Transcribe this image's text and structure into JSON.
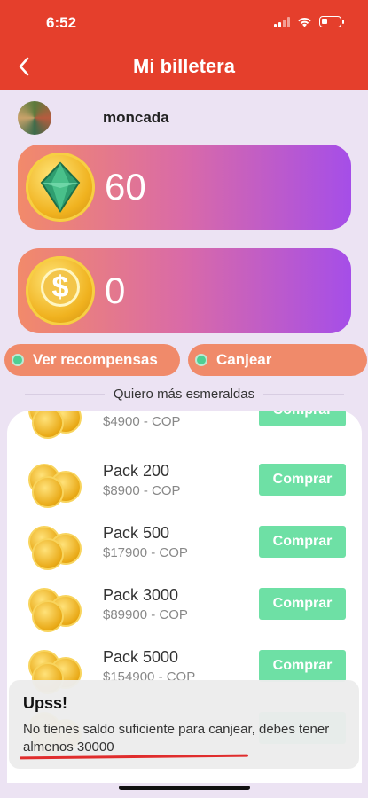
{
  "status": {
    "time": "6:52"
  },
  "header": {
    "back_icon": "back-chevron-icon",
    "title": "Mi billetera"
  },
  "user": {
    "name": "moncada"
  },
  "balances": {
    "emeralds": "60",
    "coins": "0"
  },
  "actions": {
    "rewards_label": "Ver recompensas",
    "redeem_label": "Canjear"
  },
  "section": {
    "title": "Quiero más esmeraldas"
  },
  "packs": [
    {
      "name": "",
      "price": "$4900 - COP",
      "button": "Comprar"
    },
    {
      "name": "Pack 200",
      "price": "$8900 - COP",
      "button": "Comprar"
    },
    {
      "name": "Pack 500",
      "price": "$17900 - COP",
      "button": "Comprar"
    },
    {
      "name": "Pack 3000",
      "price": "$89900 - COP",
      "button": "Comprar"
    },
    {
      "name": "Pack 5000",
      "price": "$154900 - COP",
      "button": "Comprar"
    },
    {
      "name": "",
      "price": "",
      "button": ""
    }
  ],
  "toast": {
    "title": "Upss!",
    "message": "No tienes saldo suficiente para canjear, debes tener almenos 30000"
  },
  "colors": {
    "header": "#e53f2c",
    "buy_button": "#6ee0a5",
    "pill": "#f08a6a"
  }
}
